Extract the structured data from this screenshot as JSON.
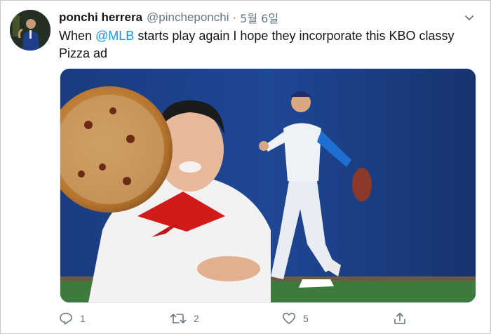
{
  "tweet": {
    "author_name": "ponchi herrera",
    "author_handle": "@pincheponchi",
    "separator": "·",
    "date": "5월 6일",
    "text_before": "When ",
    "mention": "@MLB",
    "text_after": " starts play again I hope they incorporate this KBO classy Pizza ad",
    "colors": {
      "link": "#1b95e0",
      "muted": "#657786",
      "text": "#14171a"
    }
  },
  "actions": {
    "reply": {
      "icon": "reply-icon",
      "count": "1"
    },
    "retweet": {
      "icon": "retweet-icon",
      "count": "2"
    },
    "like": {
      "icon": "heart-icon",
      "count": "5"
    },
    "share": {
      "icon": "share-icon",
      "count": ""
    }
  },
  "menu": {
    "icon": "chevron-down-icon"
  }
}
